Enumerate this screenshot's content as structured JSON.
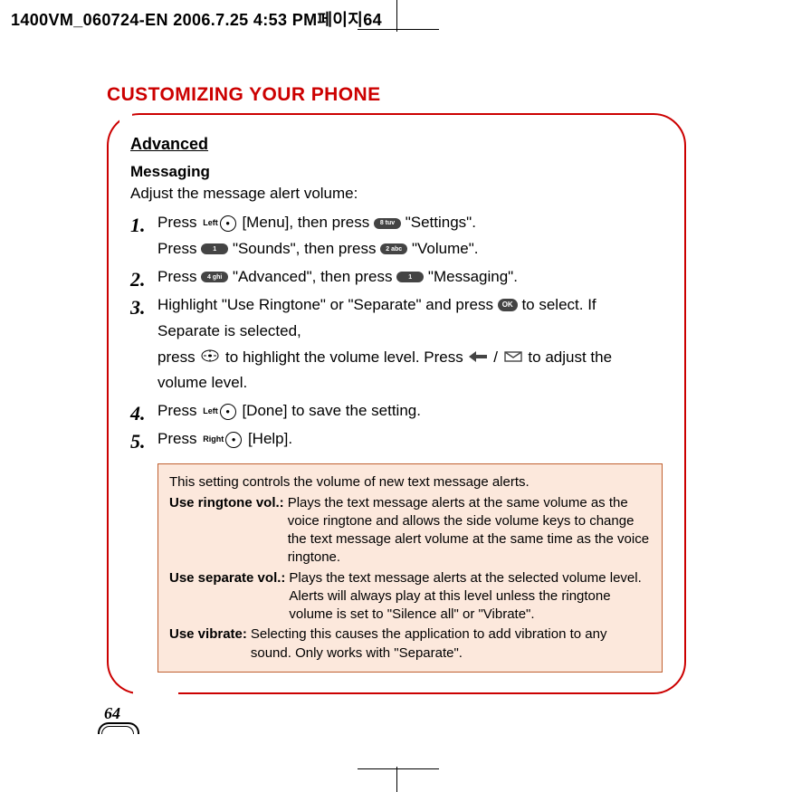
{
  "header": "1400VM_060724-EN  2006.7.25 4:53 PM페이지64",
  "title": "CUSTOMIZING YOUR PHONE",
  "section": "Advanced",
  "subsection": "Messaging",
  "introText": "Adjust the message alert volume:",
  "page_number": "64",
  "steps": {
    "s1a_press": "Press",
    "s1a_menu": "[Menu], then press",
    "s1a_settings": "\"Settings\".",
    "s1b_press": "Press",
    "s1b_sounds": "\"Sounds\", then press",
    "s1b_volume": "\"Volume\".",
    "s2_press": "Press",
    "s2_adv": "\"Advanced\", then press",
    "s2_msg": "\"Messaging\".",
    "s3_a": "Highlight \"Use Ringtone\" or \"Separate\" and press",
    "s3_b": "to select.  If Separate is selected,",
    "s3_c": "press",
    "s3_d": "to highlight the volume level.  Press",
    "s3_e": "/",
    "s3_f": "to adjust the volume level.",
    "s4_press": "Press",
    "s4_done": "[Done] to save the setting.",
    "s5_press": "Press",
    "s5_help": "[Help]."
  },
  "keys": {
    "left": "Left",
    "right": "Right",
    "k8": "8 tuv",
    "k1": "1",
    "k2": "2 abc",
    "k4": "4 ghi",
    "ok": "OK"
  },
  "infobox": {
    "intro": "This setting controls the volume of new text message alerts.",
    "r1_l": "Use ringtone vol.:",
    "r1_v": "Plays the text message alerts at the same volume as the voice ringtone and allows the side volume keys to change the text message alert volume at the same time as the voice ringtone.",
    "r2_l": "Use separate vol.:",
    "r2_v": "Plays the text message alerts at the selected volume level. Alerts will always play at this level unless the ringtone volume is set to \"Silence all\" or \"Vibrate\".",
    "r3_l": "Use vibrate:",
    "r3_v": "Selecting this causes the application to add vibration to any sound. Only works with \"Separate\"."
  }
}
